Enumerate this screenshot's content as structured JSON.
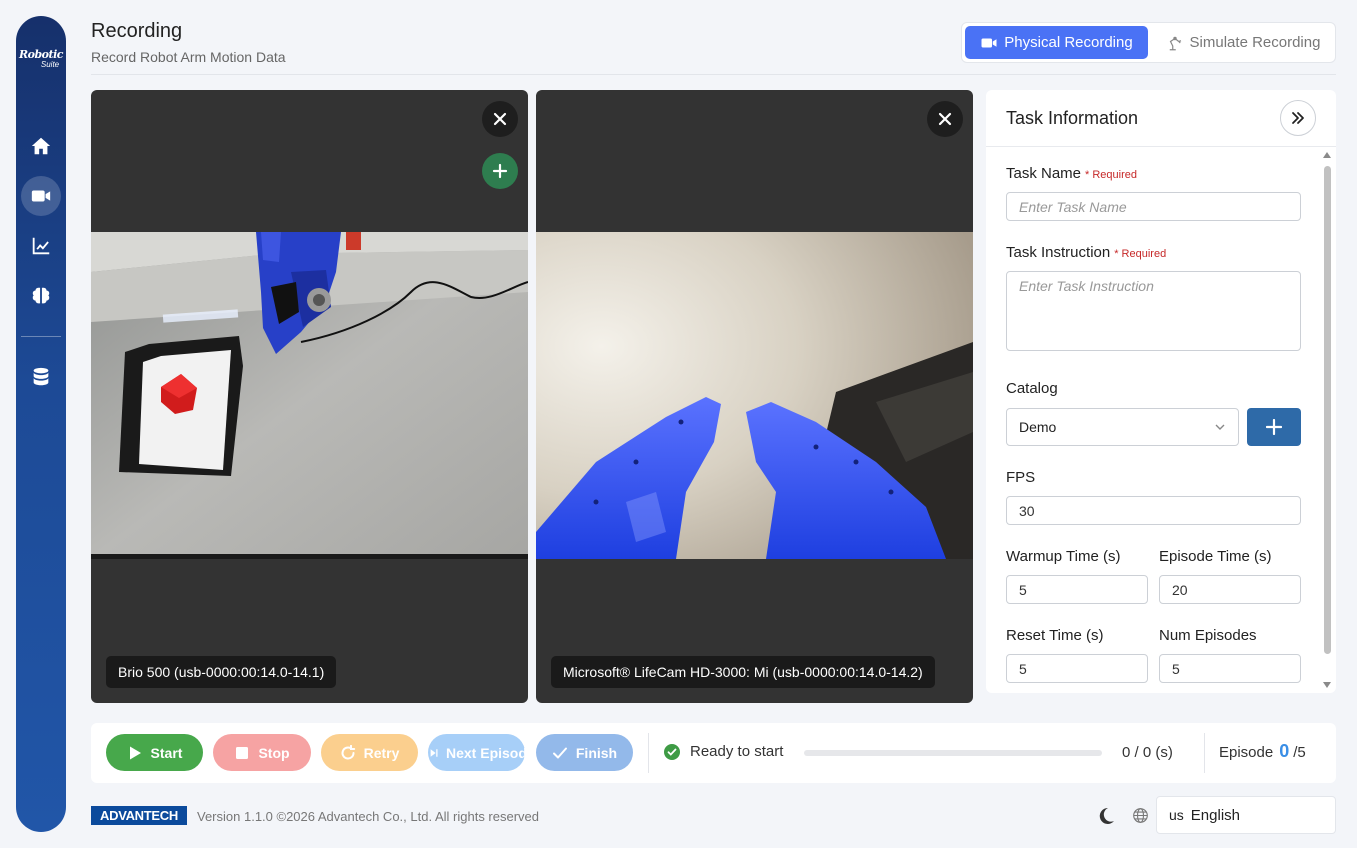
{
  "sidebar": {
    "logo_line1": "Robotic",
    "logo_line2": "Suite"
  },
  "header": {
    "title": "Recording",
    "subtitle": "Record Robot Arm Motion Data"
  },
  "mode_switch": {
    "physical_label": "Physical Recording",
    "simulate_label": "Simulate Recording"
  },
  "cameras": [
    {
      "label": "Brio 500 (usb-0000:00:14.0-14.1)"
    },
    {
      "label": "Microsoft® LifeCam HD-3000: Mi (usb-0000:00:14.0-14.2)"
    }
  ],
  "task_panel": {
    "title": "Task Information",
    "task_name": {
      "label": "Task Name",
      "required": "* Required",
      "placeholder": "Enter Task Name",
      "value": ""
    },
    "task_instruction": {
      "label": "Task Instruction",
      "required": "* Required",
      "placeholder": "Enter Task Instruction",
      "value": ""
    },
    "catalog": {
      "label": "Catalog",
      "value": "Demo"
    },
    "fps": {
      "label": "FPS",
      "value": "30"
    },
    "warmup_time": {
      "label": "Warmup Time (s)",
      "value": "5"
    },
    "episode_time": {
      "label": "Episode Time (s)",
      "value": "20"
    },
    "reset_time": {
      "label": "Reset Time (s)",
      "value": "5"
    },
    "num_episodes": {
      "label": "Num Episodes",
      "value": "5"
    }
  },
  "controls": {
    "start_label": "Start",
    "stop_label": "Stop",
    "retry_label": "Retry",
    "next_label": "Next Episode",
    "finish_label": "Finish",
    "status_text": "Ready to start",
    "progress_fraction": 0,
    "progress_text": "0 / 0 (s)",
    "episode_label": "Episode",
    "episode_current": "0",
    "episode_total": "/5"
  },
  "footer": {
    "brand": "ADVANTECH",
    "version": "Version 1.1.0 ©2026 Advantech Co., Ltd. All rights reserved",
    "lang_code": "us",
    "lang_label": "English"
  },
  "colors": {
    "accent": "#4a72f5",
    "start": "#47a84b",
    "stop": "#f6a3a3",
    "retry": "#fbcf8e",
    "next": "#a7cff8",
    "finish": "#93b9ea",
    "sidebar": "#1d4a96"
  }
}
